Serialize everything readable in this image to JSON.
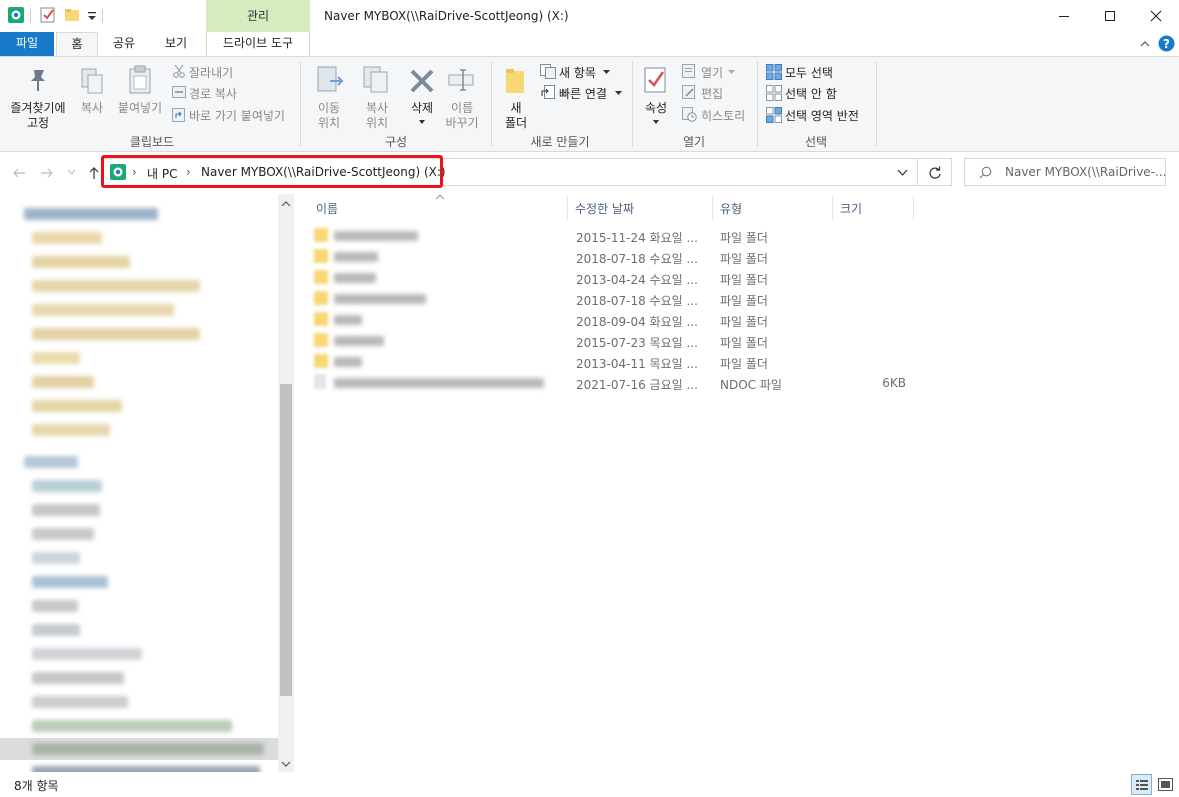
{
  "title": "Naver MYBOX(\\\\RaiDrive-ScottJeong) (X:)",
  "contextual_tab_group": "관리",
  "tabs": [
    "파일",
    "홈",
    "공유",
    "보기",
    "드라이브 도구"
  ],
  "ribbon": {
    "clipboard": {
      "pin_line1": "즐겨찾기에",
      "pin_line2": "고정",
      "copy": "복사",
      "paste": "붙여넣기",
      "cut": "잘라내기",
      "copy_path": "경로 복사",
      "paste_shortcut": "바로 가기 붙여넣기",
      "label": "클립보드"
    },
    "organize": {
      "move_line1": "이동",
      "move_line2": "위치",
      "copyto_line1": "복사",
      "copyto_line2": "위치",
      "delete": "삭제",
      "rename_line1": "이름",
      "rename_line2": "바꾸기",
      "label": "구성"
    },
    "new": {
      "folder_line1": "새",
      "folder_line2": "폴더",
      "new_item": "새 항목",
      "easy_access": "빠른 연결",
      "label": "새로 만들기"
    },
    "open": {
      "properties": "속성",
      "open": "열기",
      "edit": "편집",
      "history": "히스토리",
      "label": "열기"
    },
    "select": {
      "select_all": "모두 선택",
      "select_none": "선택 안 함",
      "invert": "선택 영역 반전",
      "label": "선택"
    }
  },
  "address": {
    "crumbs": [
      "내 PC",
      "Naver MYBOX(\\\\RaiDrive-ScottJeong) (X:)"
    ],
    "search_placeholder": "Naver MYBOX(\\\\RaiDrive-..."
  },
  "columns": {
    "name": "이름",
    "modified": "수정한 날짜",
    "type": "유형",
    "size": "크기"
  },
  "files": [
    {
      "kind": "folder",
      "date": "2015-11-24 화요일 ...",
      "type": "파일 폴더",
      "size": ""
    },
    {
      "kind": "folder",
      "date": "2018-07-18 수요일 ...",
      "type": "파일 폴더",
      "size": ""
    },
    {
      "kind": "folder",
      "date": "2013-04-24 수요일 ...",
      "type": "파일 폴더",
      "size": ""
    },
    {
      "kind": "folder",
      "date": "2018-07-18 수요일 ...",
      "type": "파일 폴더",
      "size": ""
    },
    {
      "kind": "folder",
      "date": "2018-09-04 화요일 ...",
      "type": "파일 폴더",
      "size": ""
    },
    {
      "kind": "folder",
      "date": "2015-07-23 목요일 ...",
      "type": "파일 폴더",
      "size": ""
    },
    {
      "kind": "folder",
      "date": "2013-04-11 목요일 ...",
      "type": "파일 폴더",
      "size": ""
    },
    {
      "kind": "doc",
      "date": "2021-07-16 금요일 ...",
      "type": "NDOC 파일",
      "size": "6KB"
    }
  ],
  "status": {
    "count": "8개 항목"
  },
  "colors": {
    "file_tab": "#1979ca",
    "manage_tab": "#d6ecc0",
    "highlight": "#e8141c",
    "folder": "#f8d775"
  }
}
